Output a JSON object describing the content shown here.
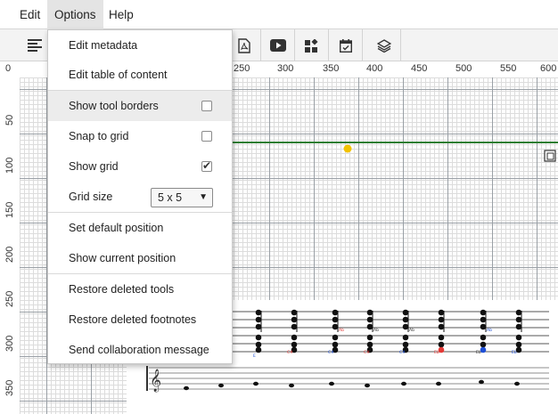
{
  "menubar": {
    "items": [
      {
        "label": "Edit"
      },
      {
        "label": "Options"
      },
      {
        "label": "Help"
      }
    ]
  },
  "toolbar": {
    "tools": [
      "align-left-icon",
      "pdf-icon",
      "play-video-icon",
      "widgets-icon",
      "calendar-icon",
      "layers-icon"
    ]
  },
  "ruler": {
    "x_labels": [
      "250",
      "300",
      "350",
      "400",
      "450",
      "500",
      "550",
      "600"
    ],
    "y_labels": [
      "0",
      "50",
      "100",
      "150",
      "200",
      "250",
      "300",
      "350"
    ]
  },
  "options_menu": {
    "items": [
      {
        "label": "Edit metadata"
      },
      {
        "label": "Edit table of content"
      },
      {
        "label": "Show tool borders",
        "checked": false
      },
      {
        "label": "Snap to grid",
        "checked": false
      },
      {
        "label": "Show grid",
        "checked": true
      },
      {
        "label": "Grid size",
        "value": "5 x 5"
      },
      {
        "label": "Set default position"
      },
      {
        "label": "Show current position"
      },
      {
        "label": "Restore deleted tools"
      },
      {
        "label": "Restore deleted footnotes"
      },
      {
        "label": "Send collaboration message"
      }
    ]
  },
  "score": {
    "chord_labels": [
      "Ab",
      "Ab",
      "Ab",
      "Ab"
    ],
    "bass_labels": [
      "E",
      "C#",
      "C#",
      "C#",
      "C#",
      "Eb",
      "Eb",
      "Eb"
    ]
  },
  "colors": {
    "accent_green": "#2e7d32",
    "marker_yellow": "#f2c200",
    "note_red": "#e53935",
    "note_blue": "#1e4fd6"
  }
}
